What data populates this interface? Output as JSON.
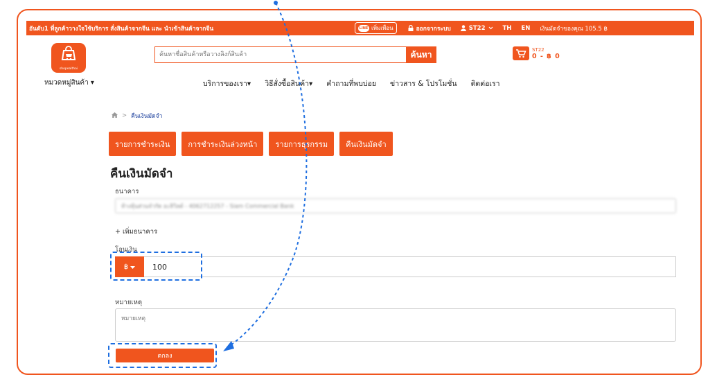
{
  "topbar": {
    "promo": "อันดับ1 ที่ลูกค้าวางใจใช้บริการ สั่งสินค้าจากจีน และ นำเข้าสินค้าจากจีน",
    "line_label": "เพิ่มเพื่อน",
    "line_icon": "LINE",
    "logout": "ออกจากระบบ",
    "user": "ST22",
    "lang_th": "TH",
    "lang_en": "EN",
    "deposit_info": "เงินมัดจำของคุณ 105.5 ฿"
  },
  "header": {
    "logo_text": "shopeaithai",
    "search_placeholder": "ค้นหาชื่อสินค้าหรือวางลิงก์สินค้า",
    "search_button": "ค้นหา",
    "cart_user": "ST22",
    "cart_amount": "0 - ฿ 0",
    "category_menu": "หมวดหมู่สินค้า ▾"
  },
  "nav": [
    {
      "label": "บริการของเรา▾"
    },
    {
      "label": "วิธีสั่งซื้อสินค้า▾"
    },
    {
      "label": "คำถามที่พบบ่อย"
    },
    {
      "label": "ข่าวสาร & โปรโมชั่น"
    },
    {
      "label": "ติดต่อเรา"
    }
  ],
  "breadcrumb": {
    "separator": ">",
    "current": "คืนเงินมัดจำ"
  },
  "tabs": [
    {
      "label": "รายการชำระเงิน"
    },
    {
      "label": "การชำระเงินล่วงหน้า"
    },
    {
      "label": "รายการธุรกรรม"
    },
    {
      "label": "คืนเงินมัดจำ"
    }
  ],
  "form": {
    "title": "คืนเงินมัดจำ",
    "bank_label": "ธนาคาร",
    "bank_value": "ห้างหุ้นส่วนจำกัด อะลิวิลด์ - 4062712257 - Siam Commercial Bank",
    "add_bank": "+ เพิ่มธนาคาร",
    "amount_label": "โอนเงิน",
    "currency": "฿",
    "amount_value": "100",
    "note_label": "หมายเหตุ",
    "note_placeholder": "หมายเหตุ",
    "submit": "ตกลง"
  },
  "colors": {
    "brand": "#f0551e",
    "annotation": "#1e6ee0"
  }
}
